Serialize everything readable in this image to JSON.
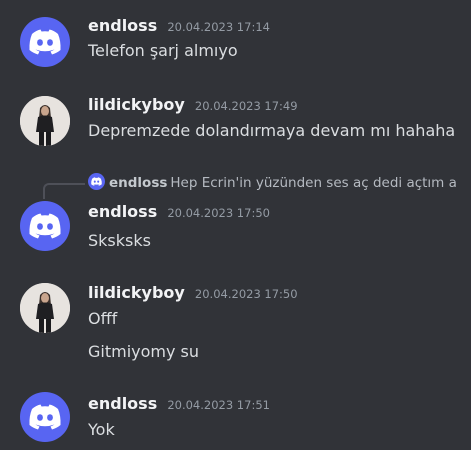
{
  "messages": [
    {
      "username": "endloss",
      "timestamp": "20.04.2023 17:14",
      "avatar_icon": "discord-logo-icon",
      "lines": [
        "Telefon şarj almıyo"
      ]
    },
    {
      "username": "lildickyboy",
      "timestamp": "20.04.2023 17:49",
      "avatar_icon": "user-photo",
      "lines": [
        "Depremzede dolandırmaya devam mı hahaha"
      ]
    },
    {
      "reply": {
        "username": "endloss",
        "text": "Hep Ecrin'in yüzünden ses aç dedi açtım a"
      },
      "username": "endloss",
      "timestamp": "20.04.2023 17:50",
      "avatar_icon": "discord-logo-icon",
      "lines": [
        "Sksksks"
      ]
    },
    {
      "username": "lildickyboy",
      "timestamp": "20.04.2023 17:50",
      "avatar_icon": "user-photo",
      "lines": [
        "Offf",
        "Gitmiyomy su"
      ]
    },
    {
      "username": "endloss",
      "timestamp": "20.04.2023 17:51",
      "avatar_icon": "discord-logo-icon",
      "lines": [
        "Yok"
      ]
    }
  ],
  "colors": {
    "background": "#313338",
    "discord_blurple": "#5865f2",
    "username": "#f2f3f5",
    "timestamp": "#949ba4",
    "text": "#dbdee1"
  }
}
